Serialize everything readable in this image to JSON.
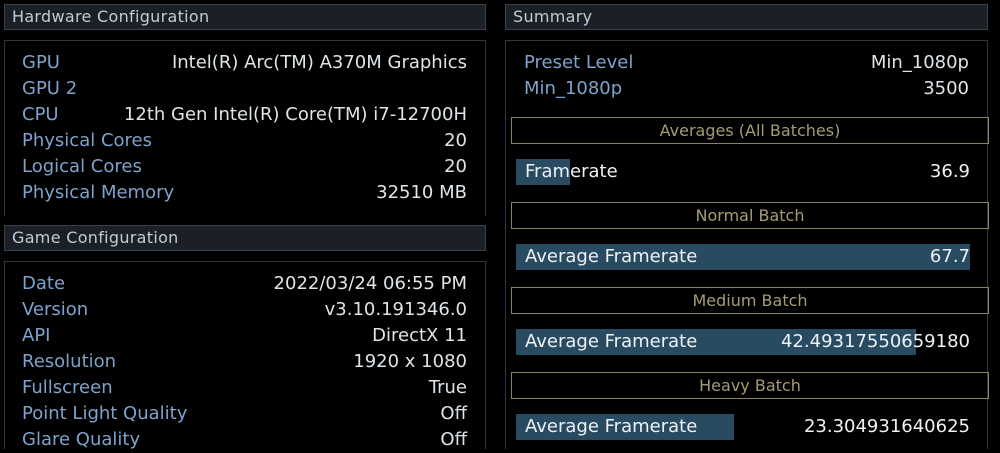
{
  "hardware": {
    "title": "Hardware Configuration",
    "rows": [
      {
        "key": "GPU",
        "value": "Intel(R) Arc(TM) A370M Graphics"
      },
      {
        "key": "GPU 2",
        "value": ""
      },
      {
        "key": "CPU",
        "value": "12th Gen Intel(R) Core(TM) i7-12700H"
      },
      {
        "key": "Physical Cores",
        "value": "20"
      },
      {
        "key": "Logical Cores",
        "value": "20"
      },
      {
        "key": "Physical Memory",
        "value": "32510 MB"
      }
    ]
  },
  "game": {
    "title": "Game Configuration",
    "rows": [
      {
        "key": "Date",
        "value": "2022/03/24 06:55 PM"
      },
      {
        "key": "Version",
        "value": "v3.10.191346.0"
      },
      {
        "key": "API",
        "value": "DirectX 11"
      },
      {
        "key": "Resolution",
        "value": "1920 x 1080"
      },
      {
        "key": "Fullscreen",
        "value": "True"
      },
      {
        "key": "Point Light Quality",
        "value": "Off"
      },
      {
        "key": "Glare Quality",
        "value": "Off"
      }
    ]
  },
  "summary": {
    "title": "Summary",
    "preset_label": "Preset Level",
    "preset_value": "Min_1080p",
    "score_label": "Min_1080p",
    "score_value": "3500",
    "averages_title": "Averages (All Batches)",
    "framerate_label": "Framerate",
    "framerate_value": "36.9",
    "framerate_fill": 0.12,
    "normal_title": "Normal Batch",
    "normal_label": "Average Framerate",
    "normal_value": "67.7",
    "normal_fill": 1.0,
    "medium_title": "Medium Batch",
    "medium_label": "Average Framerate",
    "medium_value": "42.49317550659180",
    "medium_fill": 0.88,
    "heavy_title": "Heavy Batch",
    "heavy_label": "Average Framerate",
    "heavy_value": "23.304931640625",
    "heavy_fill": 0.48
  }
}
